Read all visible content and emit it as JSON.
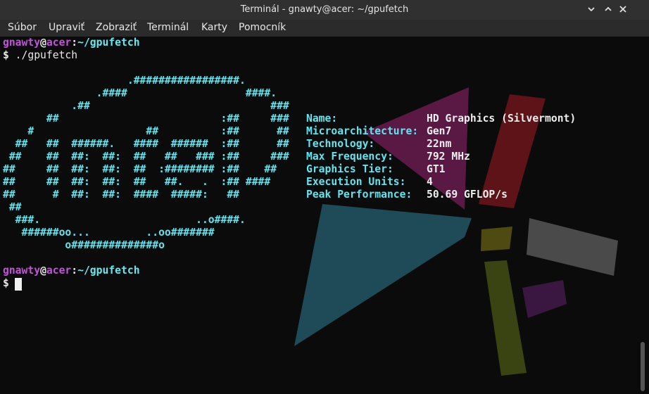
{
  "window": {
    "title": "Terminál - gnawty@acer: ~/gpufetch"
  },
  "menu": {
    "items": [
      "Súbor",
      "Upraviť",
      "Zobraziť",
      "Terminál",
      "Karty",
      "Pomocník"
    ]
  },
  "terminal": {
    "prompt1": {
      "user": "gnawty",
      "at": "@",
      "host": "acer",
      "sep": ":",
      "path": "~/gpufetch"
    },
    "command_line": {
      "dollar": "$",
      "command": " ./gpufetch"
    },
    "art": [
      "                    .#################.",
      "               .####                   ####.",
      "           .##                             ###",
      "       ##                          :##     ###",
      "    #                  ##          :##      ##",
      "  ##   ##  ######.   ####  ######  :##      ##",
      " ##    ##  ##:  ##:  ##   ##   ### :##     ###",
      "##     ##  ##:  ##:  ##  :######## :##    ##",
      "##     ##  ##:  ##:  ##   ##.   .  :## ####",
      "##      #  ##:  ##:  ####  #####:   ##",
      " ##",
      "  ###.                         ..o####.",
      "   ######oo...         ..oo#######",
      "          o##############o"
    ],
    "info": [
      {
        "key": "Name:",
        "value": "HD Graphics (Silvermont)"
      },
      {
        "key": "Microarchitecture:",
        "value": "Gen7"
      },
      {
        "key": "Technology:",
        "value": "22nm"
      },
      {
        "key": "Max Frequency:",
        "value": "792 MHz"
      },
      {
        "key": "Graphics Tier:",
        "value": "GT1"
      },
      {
        "key": "Execution Units:",
        "value": "4"
      },
      {
        "key": "Peak Performance:",
        "value": "50.69 GFLOP/s"
      }
    ],
    "prompt2": {
      "user": "gnawty",
      "at": "@",
      "host": "acer",
      "sep": ":",
      "path": "~/gpufetch"
    },
    "prompt2_dollar": "$"
  },
  "colors": {
    "prompt_user": "#c254d8",
    "prompt_path": "#67e8ef",
    "logo": "#62e4ef",
    "titlebar": "#303030",
    "menubar": "#2b2b2b",
    "terminal_bg": "#0b0b0b"
  },
  "icons": [
    "minimize-icon",
    "maximize-icon",
    "close-icon"
  ]
}
